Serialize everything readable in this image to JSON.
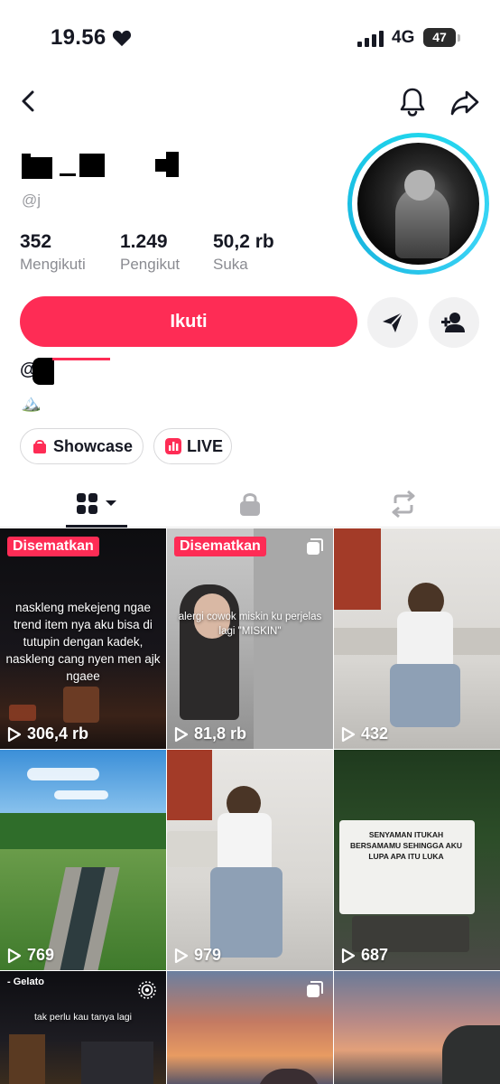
{
  "status_bar": {
    "time": "19.56",
    "network": "4G",
    "battery": "47"
  },
  "profile": {
    "username": "@j",
    "stats": [
      {
        "value": "352",
        "label": "Mengikuti"
      },
      {
        "value": "1.249",
        "label": "Pengikut"
      },
      {
        "value": "50,2 rb",
        "label": "Suka"
      }
    ],
    "bio_prefix": "@",
    "bio_emoji": "🏔️"
  },
  "actions": {
    "follow_label": "Ikuti"
  },
  "pills": [
    {
      "label": "Showcase",
      "icon": "shopping-bag-icon",
      "color": "#fe2c55"
    },
    {
      "label": "LIVE",
      "icon": "live-icon",
      "color": "#fe2c55"
    }
  ],
  "tabs": [
    {
      "name": "videos",
      "icon": "grid-icon",
      "active": true
    },
    {
      "name": "private",
      "icon": "lock-icon",
      "active": false
    },
    {
      "name": "reposts",
      "icon": "repost-icon",
      "active": false
    }
  ],
  "videos": [
    {
      "views": "306,4 rb",
      "pinned": "Disematkan",
      "caption": "naskleng mekejeng ngae trend item nya aku bisa di tutupin dengan kadek, naskleng cang nyen men ajk ngaee"
    },
    {
      "views": "81,8 rb",
      "pinned": "Disematkan",
      "caption": "alergi cowok miskin ku perjelas lagi \"MISKIN\""
    },
    {
      "views": "432"
    },
    {
      "views": "769"
    },
    {
      "views": "979"
    },
    {
      "views": "687",
      "caption": "SENYAMAN ITUKAH BERSAMAMU SEHINGGA AKU LUPA APA ITU LUKA"
    },
    {
      "caption": "tak perlu kau tanya lagi",
      "overlay_top": "- Gelato"
    },
    {},
    {}
  ],
  "colors": {
    "accent": "#fe2c55",
    "ring": "#20d5ec",
    "text": "#161823",
    "muted": "#8a8b91"
  }
}
